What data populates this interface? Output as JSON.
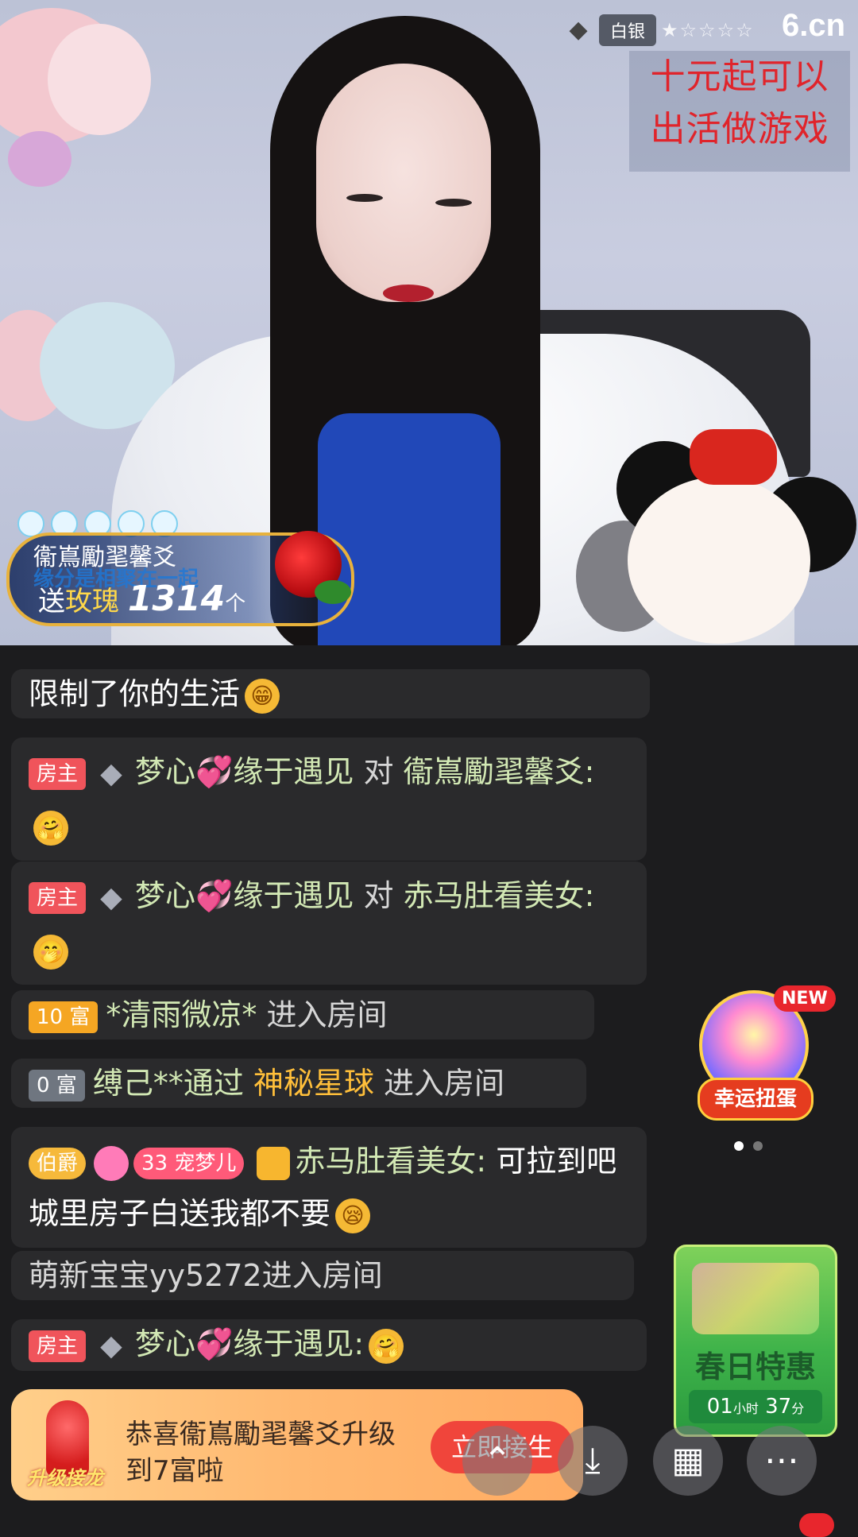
{
  "stream": {
    "rank_label": "白银",
    "rank_stars": "★☆☆☆☆",
    "site_logo": "6.cn",
    "promo_lines": [
      "十元起可以",
      "出活做游戏"
    ]
  },
  "gift": {
    "user": "衞嶌勵毣馨爻",
    "overlay_text": "缘分是相聚在一起",
    "send_prefix": "送",
    "gift_name": "玫瑰",
    "count": "1314",
    "unit": "个"
  },
  "chat": [
    {
      "text": "限制了你的生活"
    },
    {
      "badge": "房主",
      "user": "梦心",
      "user2": "缘于遇见",
      "to_word": "对",
      "target": "衞嶌勵毣馨爻:"
    },
    {
      "badge": "房主",
      "user": "梦心",
      "user2": "缘于遇见",
      "to_word": "对",
      "target": "赤马肚看美女:"
    },
    {
      "badge": "10 富",
      "user": "*清雨微凉*",
      "action": "进入房间"
    },
    {
      "badge": "0 富",
      "user": "缚己**通过",
      "via": "神秘星球",
      "action": "进入房间"
    },
    {
      "badge_noble": "伯爵",
      "badge_fan": "宠梦儿",
      "fan_level": "33",
      "user": "赤马肚看美女:",
      "message": "可拉到吧城里房子白送我都不要"
    },
    {
      "text": "萌新宝宝yy5272进入房间"
    },
    {
      "badge": "房主",
      "user": "梦心",
      "user2": "缘于遇见:"
    }
  ],
  "widgets": {
    "gacha_new": "NEW",
    "gacha_label": "幸运扭蛋",
    "spring_title": "春日特惠",
    "timer_h": "01",
    "timer_h_unit": "小时",
    "timer_m": "37",
    "timer_m_unit": "分"
  },
  "notice": {
    "rocket_label": "升级接龙",
    "text": "恭喜衞嶌勵毣馨爻升级到7富啦",
    "button": "立即接生"
  },
  "icons": {
    "share": "share-icon",
    "download": "download-icon",
    "grid": "grid-icon",
    "more": "more-icon"
  },
  "colors": {
    "owner_badge": "#f0545b",
    "username": "#d2e8b4",
    "notice_btn": "#f0453b"
  }
}
